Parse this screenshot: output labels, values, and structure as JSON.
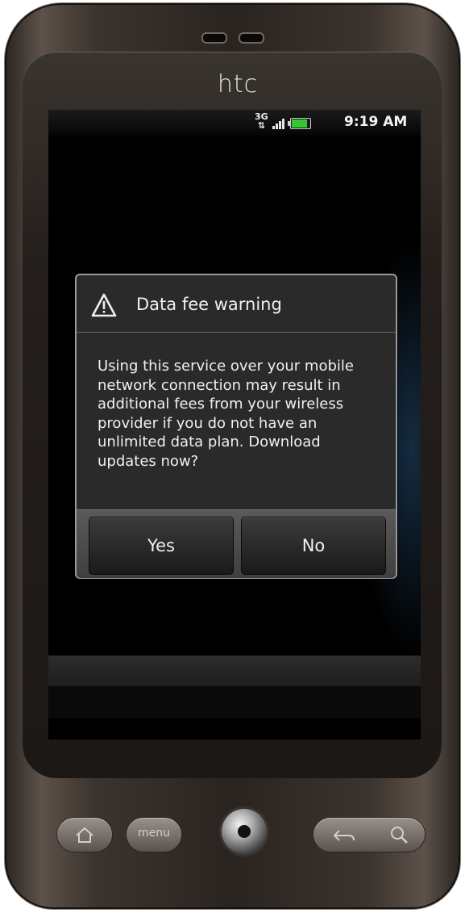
{
  "device": {
    "brand": "htc",
    "hardware_buttons": {
      "home_icon": "home-icon",
      "menu_label": "menu",
      "trackball": "trackball",
      "back_icon": "back-arrow-icon",
      "search_icon": "search-icon"
    }
  },
  "status_bar": {
    "network_label": "3G",
    "signal_icon": "signal-bars-icon",
    "battery_icon": "battery-icon",
    "time": "9:19 AM"
  },
  "dialog": {
    "icon": "warning-triangle-icon",
    "title": "Data fee warning",
    "message": "Using this service over your mobile network connection may result in additional fees from your wireless provider if you do not have an unlimited data plan. Download updates now?",
    "buttons": {
      "yes": "Yes",
      "no": "No"
    }
  },
  "colors": {
    "dialog_bg": "#2a2a2a",
    "dialog_border": "#9a9a9a",
    "battery_fill": "#32c832",
    "text": "#f0f0f0"
  }
}
